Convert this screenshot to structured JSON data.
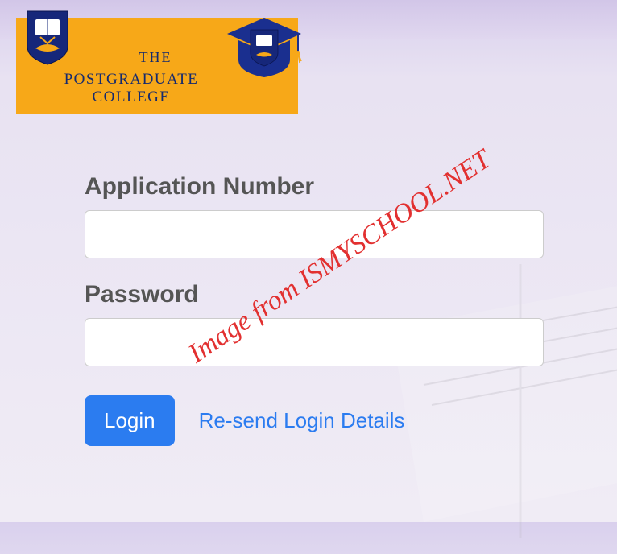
{
  "banner": {
    "the": "THE",
    "college": "POSTGRADUATE COLLEGE"
  },
  "form": {
    "application_label": "Application Number",
    "application_value": "",
    "password_label": "Password",
    "password_value": "",
    "login_label": "Login",
    "resend_label": "Re-send Login Details"
  },
  "watermark": "Image from ISMYSCHOOL.NET"
}
